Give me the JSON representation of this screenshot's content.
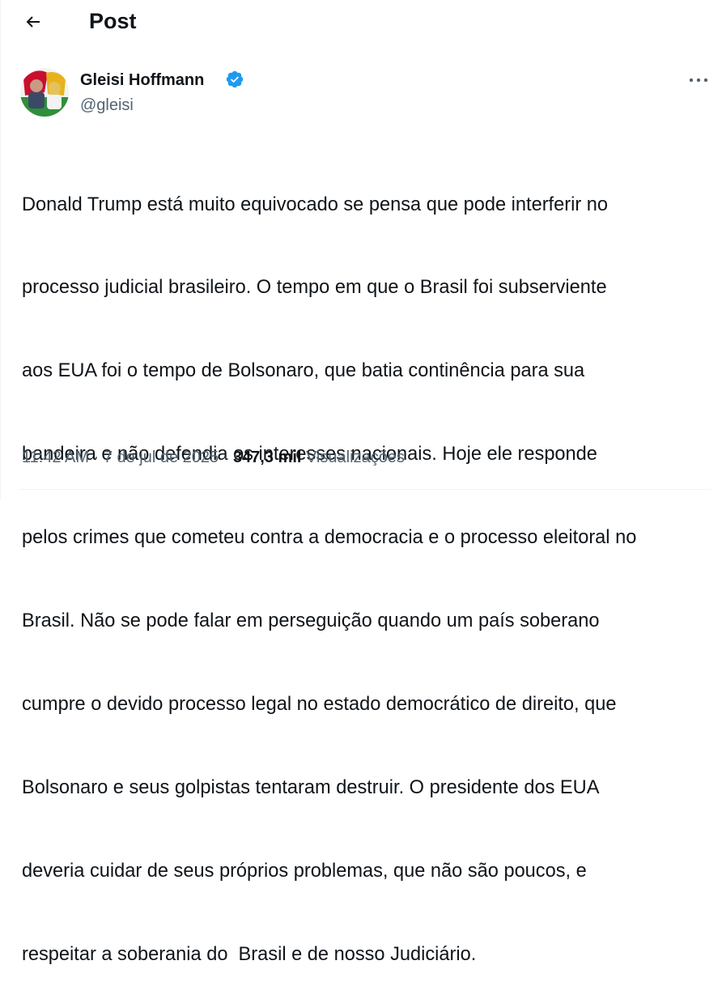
{
  "header": {
    "title": "Post",
    "back_icon": "arrow-left-icon"
  },
  "author": {
    "name": "Gleisi Hoffmann",
    "handle": "@gleisi",
    "verified_icon": "verified-badge-icon",
    "verified_color": "#1d9bf0"
  },
  "post": {
    "lines": [
      "Donald Trump está muito equivocado se pensa que pode interferir no",
      "processo judicial brasileiro. O tempo em que o Brasil foi subserviente",
      "aos EUA foi o tempo de Bolsonaro, que batia continência para sua",
      "bandeira e não defendia os interesses nacionais. Hoje ele responde",
      "pelos crimes que cometeu contra a democracia e o processo eleitoral no",
      "Brasil. Não se pode falar em perseguição quando um país soberano",
      "cumpre o devido processo legal no estado democrático de direito, que",
      "Bolsonaro e seus golpistas tentaram destruir. O presidente dos EUA",
      "deveria cuidar de seus próprios problemas, que não são poucos, e",
      "respeitar a soberania do  Brasil e de nosso Judiciário."
    ]
  },
  "meta": {
    "time": "11:42 AM",
    "separator": " · ",
    "date": "7 de jul de 2025",
    "views_count": "347,3 mil",
    "views_label": " Visualizações"
  },
  "more_icon": "more-horizontal-icon",
  "colors": {
    "text_primary": "#0f1419",
    "text_secondary": "#536471",
    "accent": "#1d9bf0",
    "divider": "#eff3f4"
  }
}
